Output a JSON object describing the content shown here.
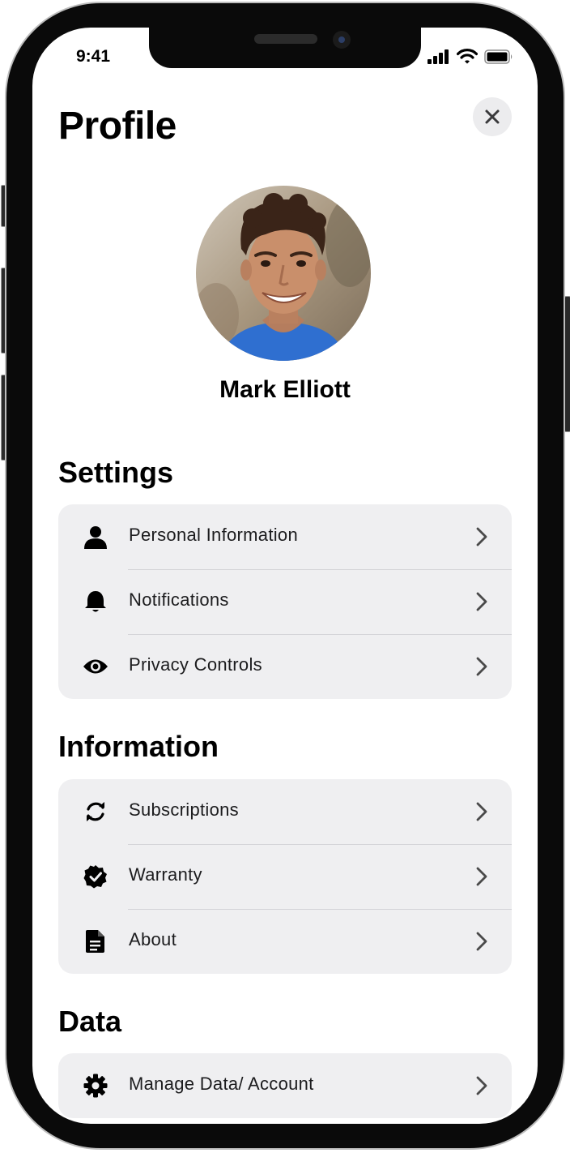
{
  "status_bar": {
    "time": "9:41"
  },
  "header": {
    "title": "Profile"
  },
  "profile": {
    "name": "Mark Elliott"
  },
  "sections": {
    "settings": {
      "title": "Settings",
      "items": [
        {
          "label": "Personal Information",
          "icon": "person-icon"
        },
        {
          "label": "Notifications",
          "icon": "bell-icon"
        },
        {
          "label": "Privacy Controls",
          "icon": "eye-icon"
        }
      ]
    },
    "information": {
      "title": "Information",
      "items": [
        {
          "label": "Subscriptions",
          "icon": "refresh-icon"
        },
        {
          "label": "Warranty",
          "icon": "verified-badge-icon"
        },
        {
          "label": "About",
          "icon": "document-icon"
        }
      ]
    },
    "data": {
      "title": "Data",
      "items": [
        {
          "label": "Manage Data/ Account",
          "icon": "gear-icon"
        }
      ]
    }
  },
  "colors": {
    "text": "#000000",
    "row_background": "#efeff1",
    "close_background": "#ececee",
    "chevron": "#4a4a4a",
    "avatar_shirt": "#2f6fd0"
  }
}
